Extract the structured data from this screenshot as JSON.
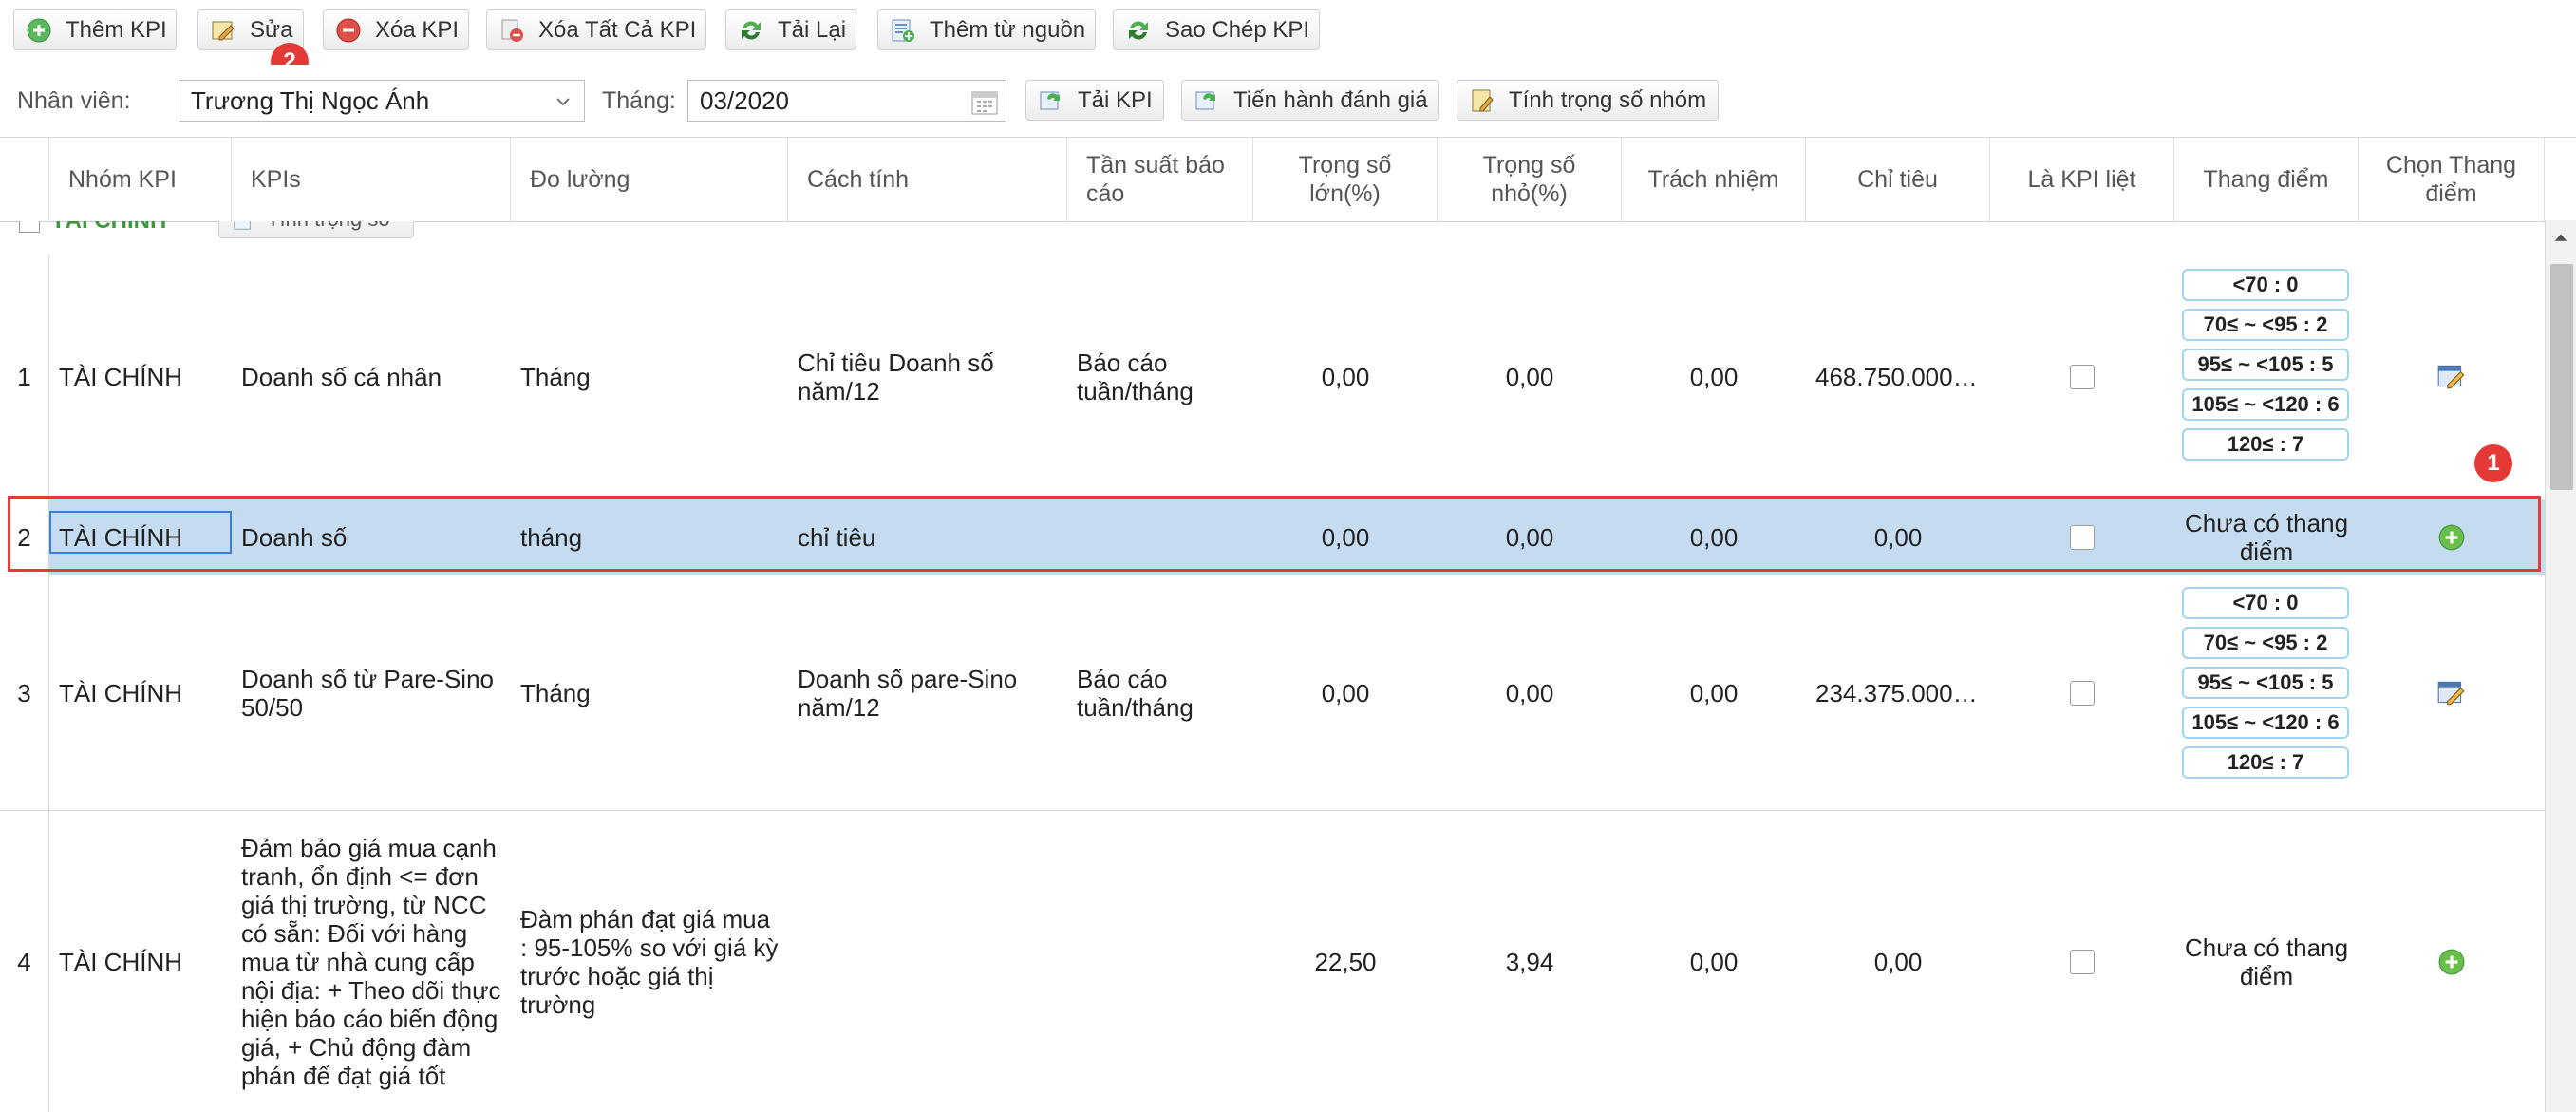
{
  "toolbar": {
    "add_kpi": "Thêm KPI",
    "edit": "Sửa",
    "delete_kpi": "Xóa KPI",
    "delete_all_kpi": "Xóa Tất Cả KPI",
    "reload": "Tải Lại",
    "add_from_source": "Thêm từ nguồn",
    "copy_kpi": "Sao Chép KPI"
  },
  "annotations": {
    "badge1": "1",
    "badge2": "2"
  },
  "filters": {
    "employee_label": "Nhân viên:",
    "employee_value": "Trương Thị Ngọc Ánh",
    "month_label": "Tháng:",
    "month_value": "03/2020",
    "load_kpi": "Tải KPI",
    "run_evaluation": "Tiến hành đánh giá",
    "calc_group_weight": "Tính trọng số nhóm"
  },
  "grid": {
    "columns": {
      "group": "Nhóm KPI",
      "kpis": "KPIs",
      "measure": "Đo lường",
      "method": "Cách tính",
      "frequency": "Tần suất báo cáo",
      "major_weight": "Trọng số lớn(%)",
      "minor_weight": "Trọng số nhỏ(%)",
      "responsibility": "Trách nhiệm",
      "target": "Chỉ tiêu",
      "is_kpi_list": "Là KPI liệt",
      "scale": "Thang điểm",
      "choose_scale": "Chọn Thang điểm"
    },
    "group_row": {
      "label": "TÀI CHÍNH",
      "button": "Tính trọng số"
    },
    "no_scale_text": "Chưa có thang điểm",
    "rows": [
      {
        "no": "1",
        "group": "TÀI CHÍNH",
        "kpi": "Doanh số cá nhân",
        "measure": "Tháng",
        "method": "Chỉ tiêu Doanh số năm/12",
        "frequency": "Báo cáo tuần/tháng",
        "major": "0,00",
        "minor": "0,00",
        "resp": "0,00",
        "target": "468.750.000…",
        "scales": [
          "<70 : 0",
          "70≤ ~ <95 : 2",
          "95≤ ~ <105 : 5",
          "105≤ ~ <120 : 6",
          "120≤ : 7"
        ]
      },
      {
        "no": "2",
        "group": "TÀI CHÍNH",
        "kpi": "Doanh số",
        "measure": "tháng",
        "method": "chỉ tiêu",
        "frequency": "",
        "major": "0,00",
        "minor": "0,00",
        "resp": "0,00",
        "target": "0,00"
      },
      {
        "no": "3",
        "group": "TÀI CHÍNH",
        "kpi": "Doanh số từ Pare-Sino 50/50",
        "measure": "Tháng",
        "method": "Doanh số pare-Sino năm/12",
        "frequency": "Báo cáo tuần/tháng",
        "major": "0,00",
        "minor": "0,00",
        "resp": "0,00",
        "target": "234.375.000…",
        "scales": [
          "<70 : 0",
          "70≤ ~ <95 : 2",
          "95≤ ~ <105 : 5",
          "105≤ ~ <120 : 6",
          "120≤ : 7"
        ]
      },
      {
        "no": "4",
        "group": "TÀI CHÍNH",
        "kpi": "Đảm bảo giá mua cạnh tranh, ổn định <= đơn giá thị trường, từ NCC có sẵn: Đối với hàng mua từ nhà cung cấp nội địa: + Theo dõi thực hiện báo cáo biến động giá, + Chủ động đàm phán để đạt giá tốt",
        "measure": "Đàm phán đạt giá mua : 95-105% so với giá kỳ trước hoặc giá thị trường",
        "method": "",
        "frequency": "",
        "major": "22,50",
        "minor": "3,94",
        "resp": "0,00",
        "target": "0,00"
      }
    ]
  },
  "colors": {
    "accent_green": "#6abf4b",
    "selection": "#c5dcf0",
    "highlight_red": "#e23b3b",
    "badge_red": "#e53935"
  },
  "icons": [
    "add-icon",
    "edit-icon",
    "delete-icon",
    "delete-all-icon",
    "reload-icon",
    "add-from-source-icon",
    "copy-icon",
    "load-icon",
    "evaluate-icon",
    "calculator-icon",
    "calendar-icon",
    "chevron-down-icon",
    "pencil-edit-icon",
    "scroll-up-icon"
  ]
}
